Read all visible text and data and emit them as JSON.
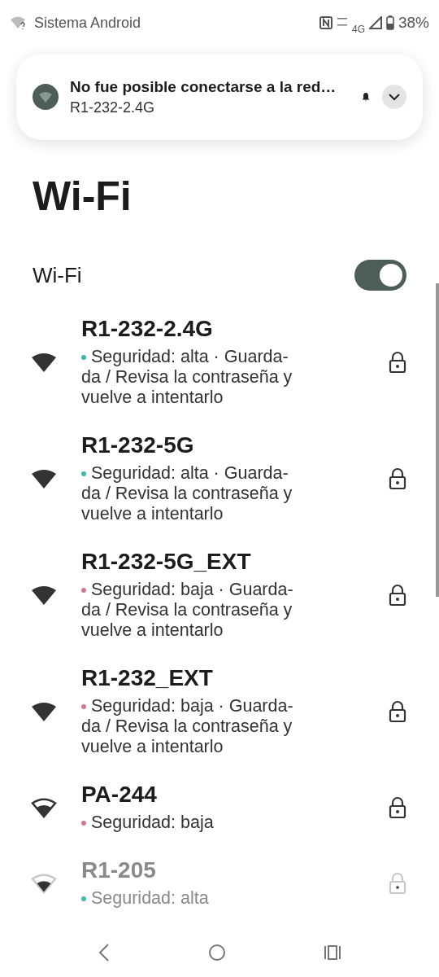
{
  "status_bar": {
    "app": "Sistema Android",
    "network": "4G",
    "battery": "38%"
  },
  "notification": {
    "title": "No fue posible conectarse a la red…",
    "subtitle": "R1-232-2.4G",
    "expanded": false
  },
  "page_title": "Wi-Fi",
  "wifi_toggle": {
    "label": "Wi-Fi",
    "on": true
  },
  "networks": [
    {
      "name": "R1-232-2.4G",
      "kind": "strong",
      "color": "#3fb8a4",
      "description": "Seguridad: alta · Guarda-da / Revisa la contraseña y vuelve a intentarlo",
      "faded": false
    },
    {
      "name": "R1-232-5G",
      "kind": "strong",
      "color": "#3fb8a4",
      "description": "Seguridad: alta · Guarda-da / Revisa la contraseña y vuelve a intentarlo",
      "faded": false
    },
    {
      "name": "R1-232-5G_EXT",
      "kind": "strong",
      "color": "#d07a8e",
      "description": "Seguridad: baja · Guarda-da / Revisa la contraseña y vuelve a intentarlo",
      "faded": false
    },
    {
      "name": "R1-232_EXT",
      "kind": "strong",
      "color": "#d07a8e",
      "description": "Seguridad: baja · Guarda-da / Revisa la contraseña y vuelve a intentarlo",
      "faded": false
    },
    {
      "name": "PA-244",
      "kind": "medium",
      "color": "#d07a8e",
      "description": "Seguridad: baja",
      "faded": false
    },
    {
      "name": "R1-205",
      "kind": "medium",
      "color": "#3fb8a4",
      "description": "Seguridad: alta",
      "faded": true
    }
  ]
}
